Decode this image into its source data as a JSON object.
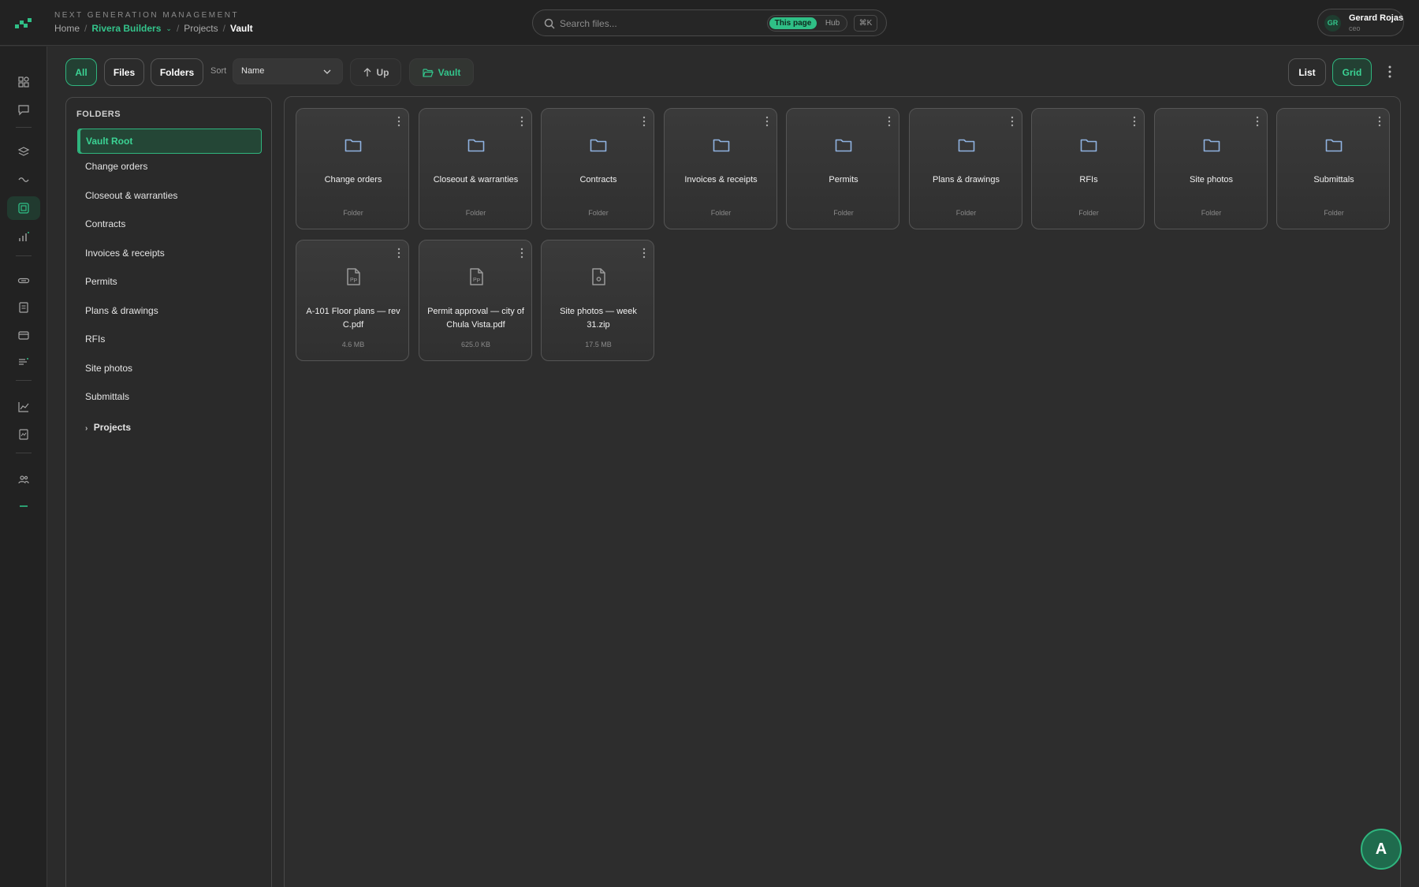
{
  "app": {
    "subtitle": "NEXT GENERATION MANAGEMENT",
    "logo_icon": "brand-logo-icon"
  },
  "breadcrumb": {
    "home": "Home",
    "company": "Rivera Builders",
    "projects": "Projects",
    "current": "Vault"
  },
  "search": {
    "placeholder": "Search files...",
    "scope_active": "This page",
    "scope_other": "Hub",
    "shortcut": "⌘K"
  },
  "user": {
    "initials": "GR",
    "name": "Gerard Rojas",
    "role": "ceo"
  },
  "rail_icons": [
    "dashboard-icon",
    "chat-icon",
    "layers-icon",
    "trend-icon",
    "vault-icon",
    "bar-chart-icon",
    "link-icon",
    "document-icon",
    "card-icon",
    "list-icon",
    "line-chart-icon",
    "report-icon",
    "team-icon",
    "minus-icon"
  ],
  "toolbar": {
    "filter_all": "All",
    "filter_files": "Files",
    "filter_folders": "Folders",
    "sort_label": "Sort",
    "sort_value": "Name",
    "up_label": "Up",
    "vault_label": "Vault",
    "view_list": "List",
    "view_grid": "Grid"
  },
  "folders_panel": {
    "title": "FOLDERS",
    "root": "Vault Root",
    "items": [
      "Change orders",
      "Closeout & warranties",
      "Contracts",
      "Invoices & receipts",
      "Permits",
      "Plans & drawings",
      "RFIs",
      "Site photos",
      "Submittals"
    ],
    "projects": "Projects"
  },
  "grid": {
    "folders": [
      {
        "name": "Change orders",
        "meta": "Folder"
      },
      {
        "name": "Closeout & warranties",
        "meta": "Folder"
      },
      {
        "name": "Contracts",
        "meta": "Folder"
      },
      {
        "name": "Invoices & receipts",
        "meta": "Folder"
      },
      {
        "name": "Permits",
        "meta": "Folder"
      },
      {
        "name": "Plans & drawings",
        "meta": "Folder"
      },
      {
        "name": "RFIs",
        "meta": "Folder"
      },
      {
        "name": "Site photos",
        "meta": "Folder"
      },
      {
        "name": "Submittals",
        "meta": "Folder"
      }
    ],
    "files": [
      {
        "name": "A-101 Floor plans — rev C.pdf",
        "meta": "4.6 MB",
        "type": "pdf"
      },
      {
        "name": "Permit approval — city of Chula Vista.pdf",
        "meta": "625.0 KB",
        "type": "pdf"
      },
      {
        "name": "Site photos — week 31.zip",
        "meta": "17.5 MB",
        "type": "zip"
      }
    ]
  },
  "assistant": {
    "label": "A"
  },
  "colors": {
    "accent": "#2fbf86",
    "background": "#2b2b2b",
    "folder_icon": "#8fb2e0"
  }
}
